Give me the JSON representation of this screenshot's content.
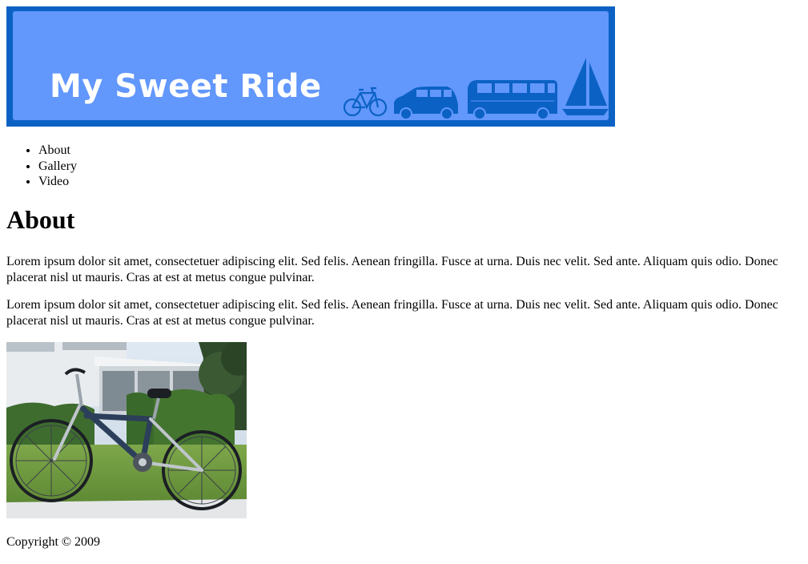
{
  "header": {
    "title": "My Sweet Ride",
    "icons": [
      "bicycle-icon",
      "car-icon",
      "bus-icon",
      "sailboat-icon"
    ],
    "colors": {
      "border": "#0b62c4",
      "fill": "#6297fc",
      "title": "#ffffff",
      "icon": "#0b62c4"
    }
  },
  "nav": {
    "items": [
      {
        "label": "About"
      },
      {
        "label": "Gallery"
      },
      {
        "label": "Video"
      }
    ]
  },
  "main": {
    "heading": "About",
    "paragraphs": [
      "Lorem ipsum dolor sit amet, consectetuer adipiscing elit. Sed felis. Aenean fringilla. Fusce at urna. Duis nec velit. Sed ante. Aliquam quis odio. Donec placerat nisl ut mauris. Cras at est at metus congue pulvinar.",
      "Lorem ipsum dolor sit amet, consectetuer adipiscing elit. Sed felis. Aenean fringilla. Fusce at urna. Duis nec velit. Sed ante. Aliquam quis odio. Donec placerat nisl ut mauris. Cras at est at metus congue pulvinar."
    ],
    "photo": "bicycle-photo"
  },
  "footer": {
    "copyright": "Copyright © 2009"
  }
}
